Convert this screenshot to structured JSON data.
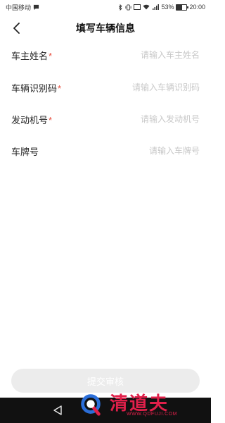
{
  "status_bar": {
    "carrier": "中国移动",
    "battery_percent": "53%",
    "battery_level": 0.53,
    "time": "20:00"
  },
  "header": {
    "title": "填写车辆信息"
  },
  "form": {
    "fields": [
      {
        "label": "车主姓名",
        "required": true,
        "required_mark": "*",
        "placeholder": "请输入车主姓名",
        "value": ""
      },
      {
        "label": "车辆识别码",
        "required": true,
        "required_mark": "*",
        "placeholder": "请输入车辆识别码",
        "value": ""
      },
      {
        "label": "发动机号",
        "required": true,
        "required_mark": "*",
        "placeholder": "请输入发动机号",
        "value": ""
      },
      {
        "label": "车牌号",
        "required": false,
        "required_mark": "",
        "placeholder": "请输入车牌号",
        "value": ""
      }
    ]
  },
  "actions": {
    "submit_label": "提交审核"
  },
  "watermark": {
    "brand": "清道夫",
    "url": "WWW.QDFUJI.COM"
  },
  "colors": {
    "required": "#e74c3c",
    "button_disabled": "#ececec",
    "watermark": "#e0204a",
    "system_nav": "#111111"
  }
}
